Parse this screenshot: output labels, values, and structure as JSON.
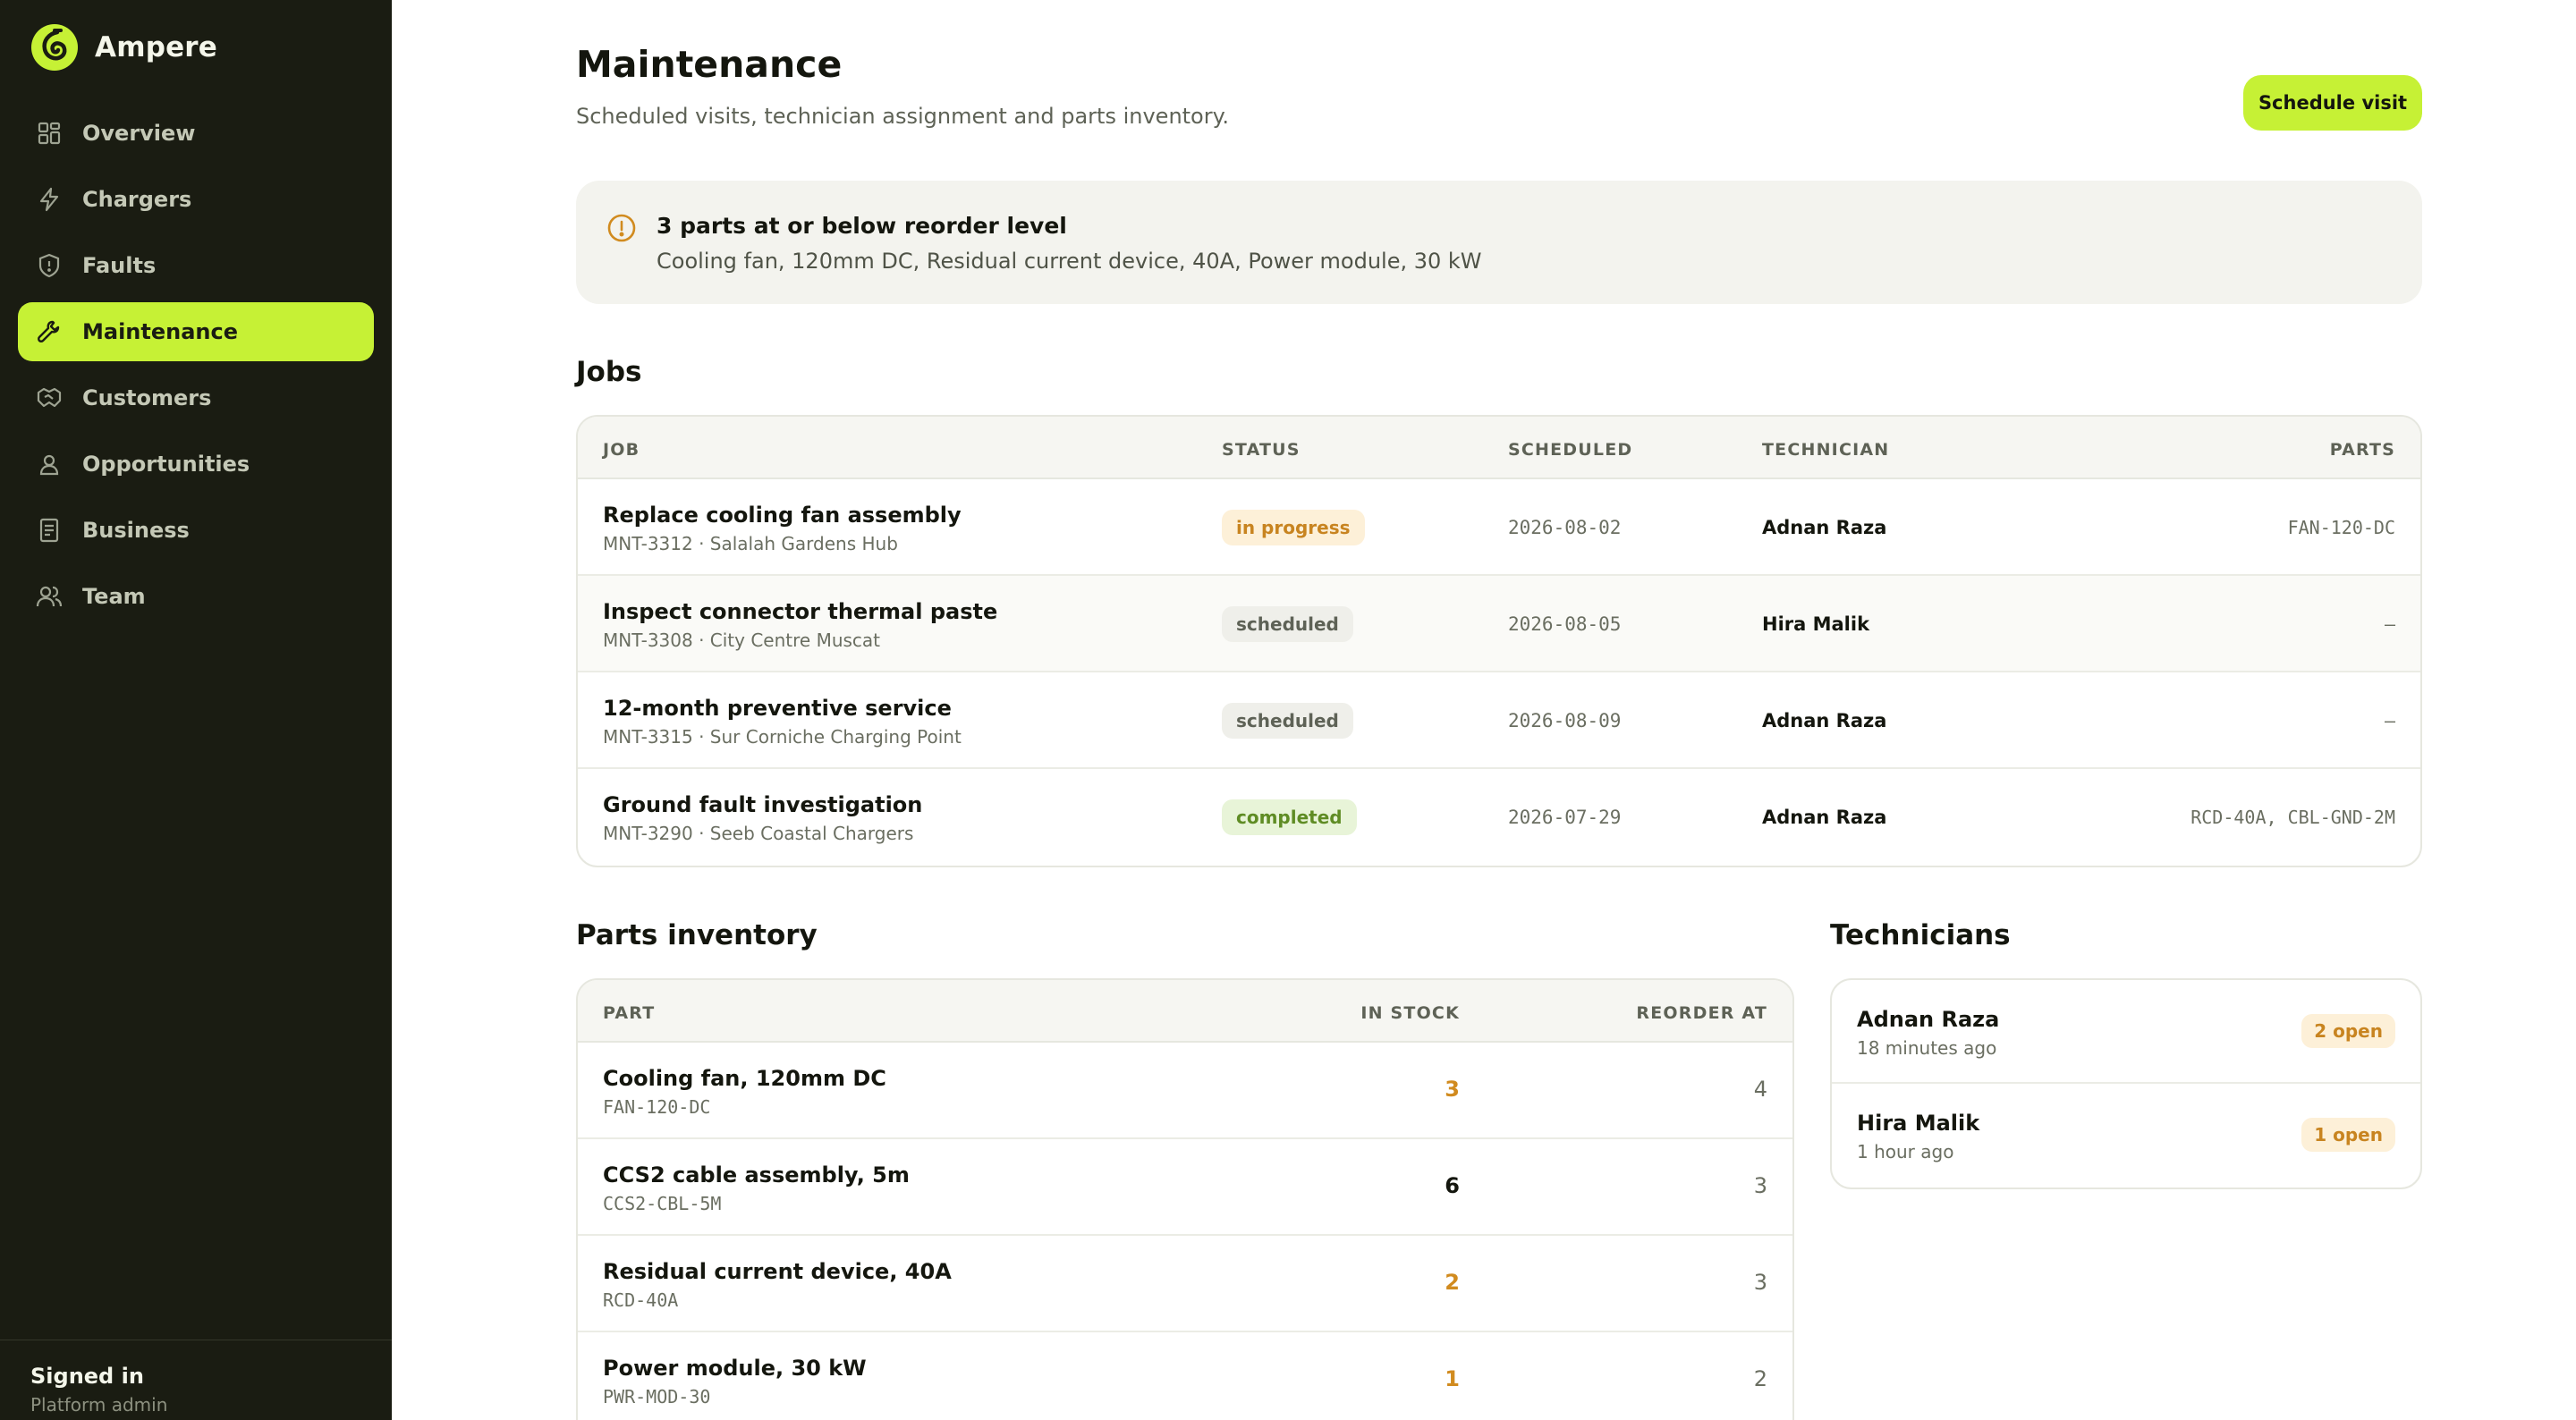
{
  "app": {
    "name": "Ampere"
  },
  "nav": [
    {
      "label": "Overview",
      "icon": "grid-icon"
    },
    {
      "label": "Chargers",
      "icon": "bolt-icon"
    },
    {
      "label": "Faults",
      "icon": "shield-alert-icon"
    },
    {
      "label": "Maintenance",
      "icon": "wrench-icon",
      "active": true
    },
    {
      "label": "Customers",
      "icon": "handshake-icon"
    },
    {
      "label": "Opportunities",
      "icon": "user-pin-icon"
    },
    {
      "label": "Business",
      "icon": "document-icon"
    },
    {
      "label": "Team",
      "icon": "users-icon"
    }
  ],
  "user": {
    "status": "Signed in",
    "role": "Platform admin"
  },
  "page": {
    "title": "Maintenance",
    "subtitle": "Scheduled visits, technician assignment and parts inventory.",
    "primary_action": "Schedule visit"
  },
  "alert": {
    "icon": "alert-circle-icon",
    "title": "3 parts at or below reorder level",
    "body": "Cooling fan, 120mm DC, Residual current device, 40A, Power module, 30 kW"
  },
  "jobs": {
    "title": "Jobs",
    "columns": [
      "Job",
      "Status",
      "Scheduled",
      "Technician",
      "Parts"
    ],
    "rows": [
      {
        "title": "Replace cooling fan assembly",
        "sub": "MNT-3312 · Salalah Gardens Hub",
        "status": "in progress",
        "status_kind": "progress",
        "scheduled": "2026-08-02",
        "technician": "Adnan Raza",
        "parts": "FAN-120-DC"
      },
      {
        "title": "Inspect connector thermal paste",
        "sub": "MNT-3308 · City Centre Muscat",
        "status": "scheduled",
        "status_kind": "scheduled",
        "scheduled": "2026-08-05",
        "technician": "Hira Malik",
        "parts": "—"
      },
      {
        "title": "12-month preventive service",
        "sub": "MNT-3315 · Sur Corniche Charging Point",
        "status": "scheduled",
        "status_kind": "scheduled",
        "scheduled": "2026-08-09",
        "technician": "Adnan Raza",
        "parts": "—"
      },
      {
        "title": "Ground fault investigation",
        "sub": "MNT-3290 · Seeb Coastal Chargers",
        "status": "completed",
        "status_kind": "completed",
        "scheduled": "2026-07-29",
        "technician": "Adnan Raza",
        "parts": "RCD-40A, CBL-GND-2M"
      }
    ]
  },
  "inventory": {
    "title": "Parts inventory",
    "columns": [
      "Part",
      "In stock",
      "Reorder at"
    ],
    "rows": [
      {
        "name": "Cooling fan, 120mm DC",
        "sku": "FAN-120-DC",
        "in_stock": "3",
        "reorder_at": "4",
        "low": true
      },
      {
        "name": "CCS2 cable assembly, 5m",
        "sku": "CCS2-CBL-5M",
        "in_stock": "6",
        "reorder_at": "3",
        "low": false
      },
      {
        "name": "Residual current device, 40A",
        "sku": "RCD-40A",
        "in_stock": "2",
        "reorder_at": "3",
        "low": true
      },
      {
        "name": "Power module, 30 kW",
        "sku": "PWR-MOD-30",
        "in_stock": "1",
        "reorder_at": "2",
        "low": true
      }
    ]
  },
  "technicians": {
    "title": "Technicians",
    "rows": [
      {
        "name": "Adnan Raza",
        "last_seen": "18 minutes ago",
        "open": "2 open"
      },
      {
        "name": "Hira Malik",
        "last_seen": "1 hour ago",
        "open": "1 open"
      }
    ]
  },
  "colors": {
    "accent": "#c6f135",
    "sidebar": "#1a1c12",
    "warning": "#d18b1f"
  }
}
